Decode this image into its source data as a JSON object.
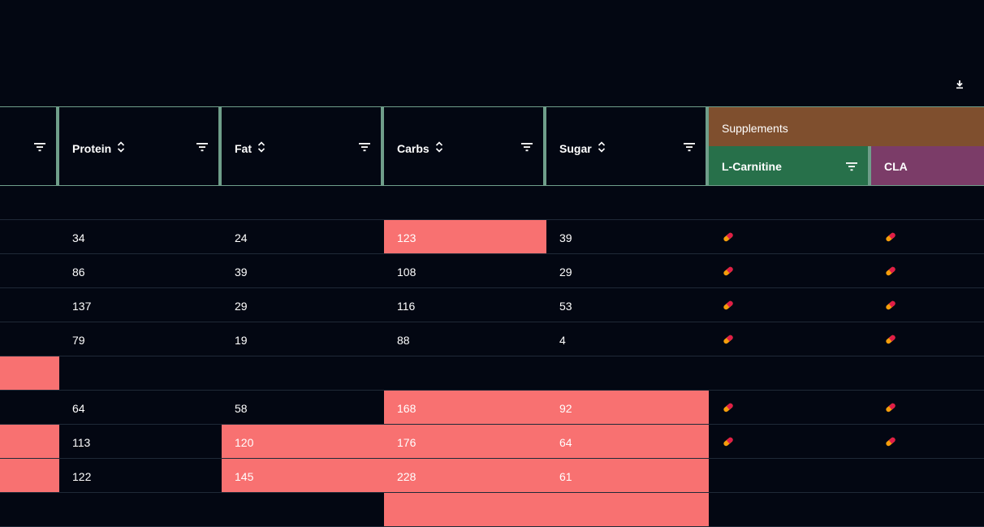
{
  "toolbar": {
    "download_icon": "download-icon"
  },
  "columns": [
    {
      "key": "protein",
      "label": "Protein"
    },
    {
      "key": "fat",
      "label": "Fat"
    },
    {
      "key": "carbs",
      "label": "Carbs"
    },
    {
      "key": "sugar",
      "label": "Sugar"
    }
  ],
  "supplements_group": {
    "label": "Supplements",
    "columns": [
      {
        "key": "l_carnitine",
        "label": "L-Carnitine",
        "color": "#27704a"
      },
      {
        "key": "cla",
        "label": "CLA",
        "color": "#7b3c68"
      }
    ]
  },
  "colors": {
    "background": "#030712",
    "highlight": "#f87171",
    "header_border": "#6f9e8a",
    "supplements_header": "#7f4f2e",
    "l_carnitine_header": "#27704a",
    "cla_header": "#7b3c68"
  },
  "rows": [
    {
      "protein": "",
      "fat": "",
      "carbs": "",
      "sugar": "",
      "pills": [
        false,
        false
      ],
      "hl": []
    },
    {
      "protein": "34",
      "fat": "24",
      "carbs": "123",
      "sugar": "39",
      "pills": [
        true,
        true
      ],
      "hl": [
        "carbs"
      ]
    },
    {
      "protein": "86",
      "fat": "39",
      "carbs": "108",
      "sugar": "29",
      "pills": [
        true,
        true
      ],
      "hl": []
    },
    {
      "protein": "137",
      "fat": "29",
      "carbs": "116",
      "sugar": "53",
      "pills": [
        true,
        true
      ],
      "hl": []
    },
    {
      "protein": "79",
      "fat": "19",
      "carbs": "88",
      "sugar": "4",
      "pills": [
        true,
        true
      ],
      "hl": []
    },
    {
      "protein": "",
      "fat": "",
      "carbs": "",
      "sugar": "",
      "pills": [
        false,
        false
      ],
      "hl": [
        "first"
      ]
    },
    {
      "protein": "64",
      "fat": "58",
      "carbs": "168",
      "sugar": "92",
      "pills": [
        true,
        true
      ],
      "hl": [
        "carbs",
        "sugar"
      ]
    },
    {
      "protein": "113",
      "fat": "120",
      "carbs": "176",
      "sugar": "64",
      "pills": [
        true,
        true
      ],
      "hl": [
        "first",
        "fat",
        "carbs",
        "sugar"
      ]
    },
    {
      "protein": "122",
      "fat": "145",
      "carbs": "228",
      "sugar": "61",
      "pills": [
        false,
        false
      ],
      "hl": [
        "first",
        "fat",
        "carbs",
        "sugar"
      ]
    },
    {
      "protein": "",
      "fat": "",
      "carbs": "",
      "sugar": "",
      "pills": [
        false,
        false
      ],
      "hl": [
        "carbs",
        "sugar"
      ]
    }
  ]
}
